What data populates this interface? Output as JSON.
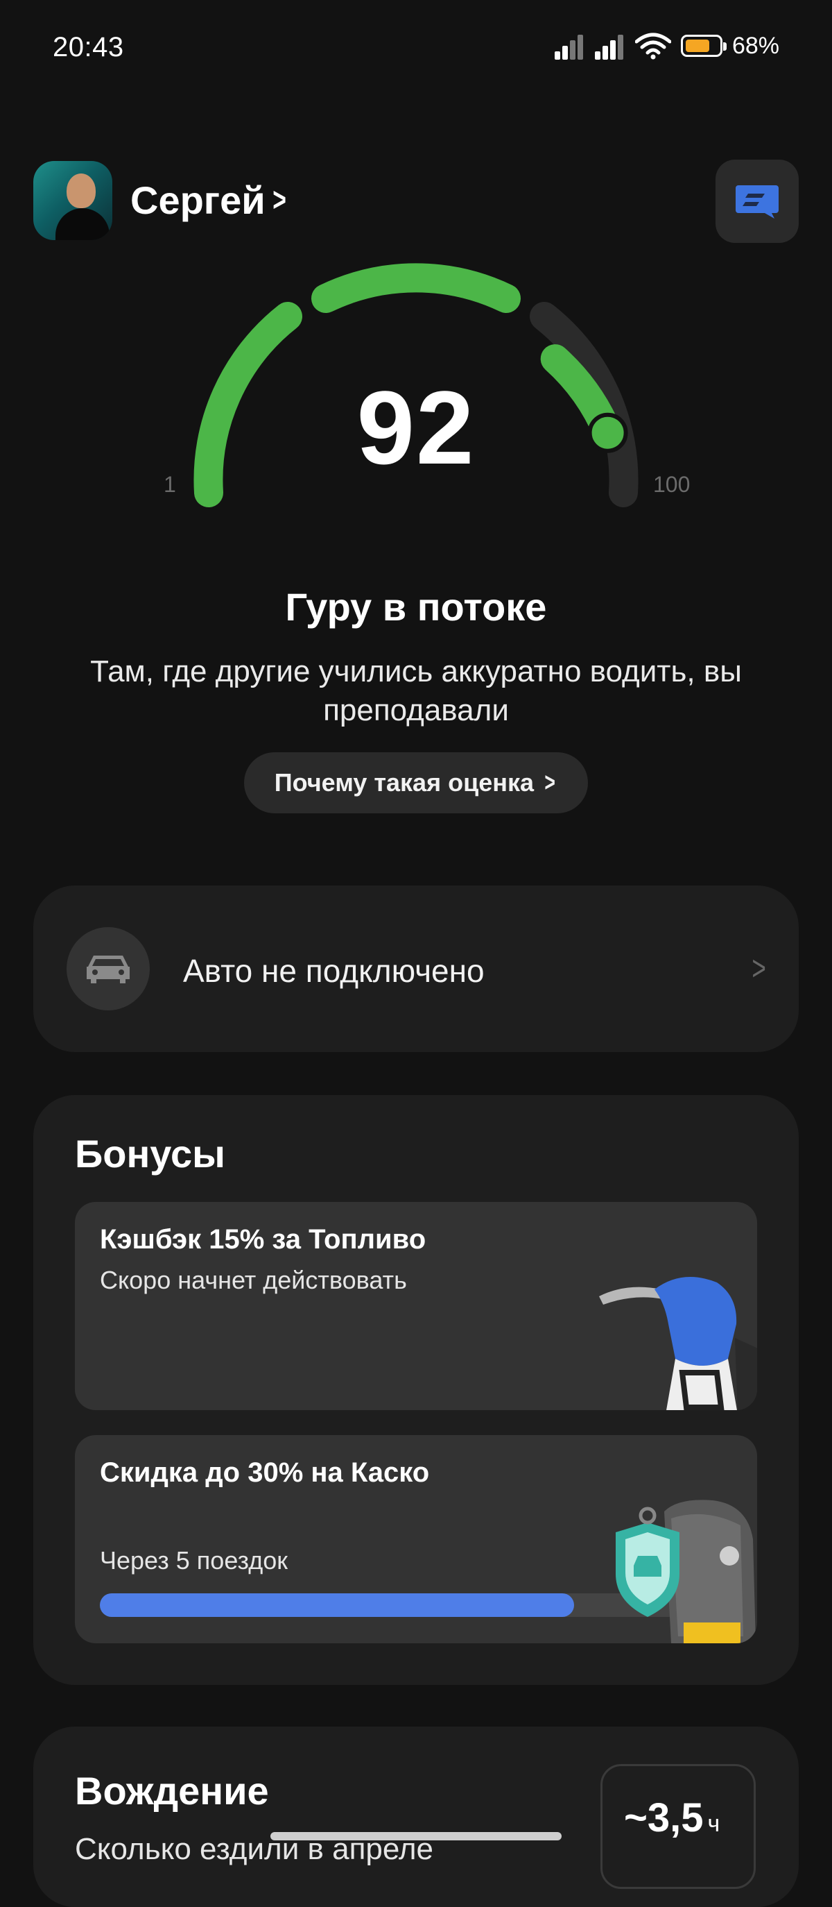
{
  "status_bar": {
    "time": "20:43",
    "battery_percent": "68%",
    "battery_color": "#f5a623"
  },
  "user": {
    "name": "Сергей"
  },
  "gauge": {
    "score": "92",
    "min_label": "1",
    "max_label": "100",
    "value_fraction": 0.92,
    "color": "#4cb648"
  },
  "rating": {
    "title": "Гуру в потоке",
    "description": "Там, где другие учились аккуратно водить, вы преподавали",
    "why_button": "Почему такая оценка"
  },
  "car": {
    "label": "Авто не подключено"
  },
  "bonuses": {
    "title": "Бонусы",
    "offers": [
      {
        "title": "Кэшбэк 15% за Топливо",
        "subtitle": "Скоро начнет действовать",
        "icon": "fuel-nozzle-icon"
      },
      {
        "title": "Скидка до 30% на Каско",
        "subtitle": "Через 5 поездок",
        "icon": "car-key-shield-icon",
        "progress_fraction": 0.75,
        "progress_color": "#4f7ee8"
      }
    ]
  },
  "driving": {
    "title": "Вождение",
    "subtitle": "Сколько ездили в апреле",
    "hours_value": "~3,5",
    "hours_unit": "ч"
  }
}
